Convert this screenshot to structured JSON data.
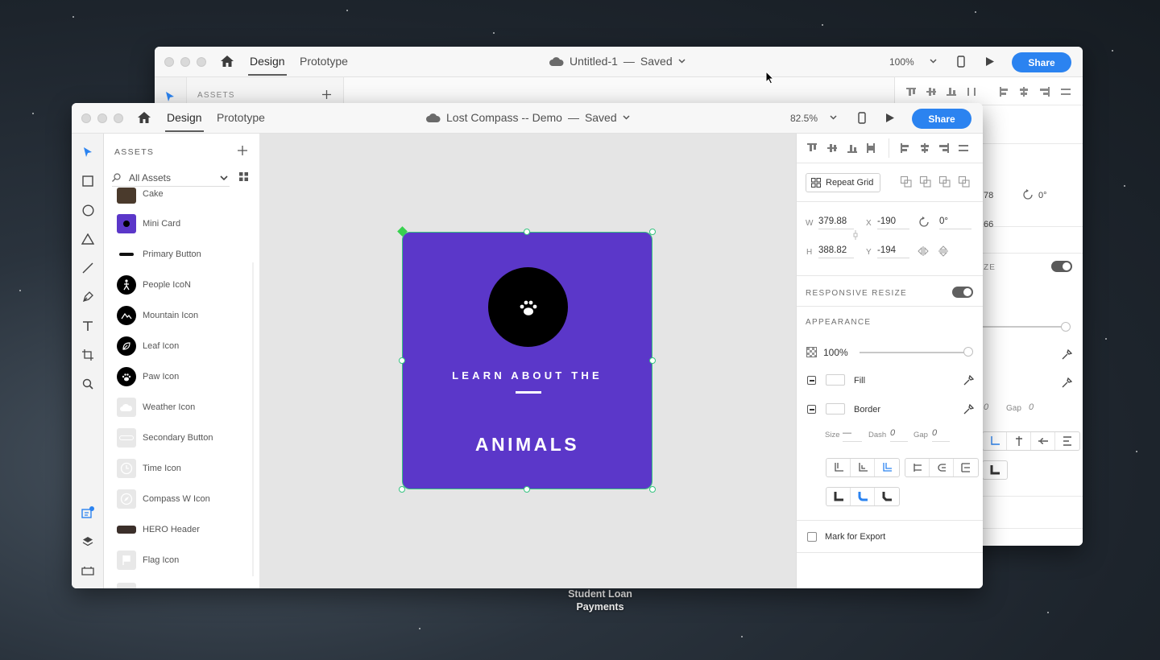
{
  "desktop": {
    "file_label": "Student Loan\nPayments"
  },
  "back_window": {
    "tabs": [
      "Design",
      "Prototype"
    ],
    "document_title": "Untitled-1",
    "document_status": "Saved",
    "separator": "—",
    "zoom": "100%",
    "share_label": "Share",
    "assets_label": "ASSETS",
    "partial_values": {
      "width_tail": "78",
      "height_tail": "66",
      "rotation": "0°",
      "resize_tail": "ZE",
      "dash_tail": "h",
      "dash_value": "0",
      "gap_label": "Gap",
      "gap_value": "0"
    }
  },
  "front_window": {
    "tabs": {
      "design": "Design",
      "prototype": "Prototype"
    },
    "document_title": "Lost Compass -- Demo",
    "document_status": "Saved",
    "separator": "—",
    "zoom": "82.5%",
    "share_label": "Share",
    "assets": {
      "title": "ASSETS",
      "filter_label": "All Assets",
      "items": [
        {
          "label": "Cake",
          "icon": "cake-thumbnail"
        },
        {
          "label": "Mini Card",
          "icon": "mini-card-thumbnail"
        },
        {
          "label": "Primary Button",
          "icon": "primary-button-thumbnail"
        },
        {
          "label": "People IcoN",
          "icon": "person-walking-icon"
        },
        {
          "label": "Mountain Icon",
          "icon": "mountain-icon"
        },
        {
          "label": "Leaf Icon",
          "icon": "leaf-icon"
        },
        {
          "label": "Paw Icon",
          "icon": "paw-icon"
        },
        {
          "label": "Weather Icon",
          "icon": "weather-icon"
        },
        {
          "label": "Secondary Button",
          "icon": "secondary-button-thumbnail"
        },
        {
          "label": "Time Icon",
          "icon": "clock-icon"
        },
        {
          "label": "Compass W Icon",
          "icon": "compass-icon"
        },
        {
          "label": "HERO Header",
          "icon": "hero-header-thumbnail"
        },
        {
          "label": "Flag Icon",
          "icon": "flag-icon"
        }
      ]
    },
    "artboard": {
      "subtitle": "LEARN ABOUT THE",
      "title": "ANIMALS",
      "background": "#5b37c9",
      "icon": "paw-icon"
    },
    "properties": {
      "repeat_grid_label": "Repeat Grid",
      "w_label": "W",
      "w_value": "379.88",
      "h_label": "H",
      "h_value": "388.82",
      "x_label": "X",
      "x_value": "-190",
      "y_label": "Y",
      "y_value": "-194",
      "rotation_value": "0°",
      "responsive_resize_label": "RESPONSIVE RESIZE",
      "responsive_resize_on": true,
      "appearance_label": "APPEARANCE",
      "opacity_value": "100%",
      "opacity_fraction": 1.0,
      "fill_label": "Fill",
      "border_label": "Border",
      "size_label": "Size",
      "size_value": "—",
      "dash_label": "Dash",
      "dash_value": "0",
      "gap_label": "Gap",
      "gap_value": "0",
      "export_label": "Mark for Export"
    }
  },
  "colors": {
    "accent": "#2b83f0",
    "artboard": "#5b37c9",
    "selection": "#35c480"
  }
}
